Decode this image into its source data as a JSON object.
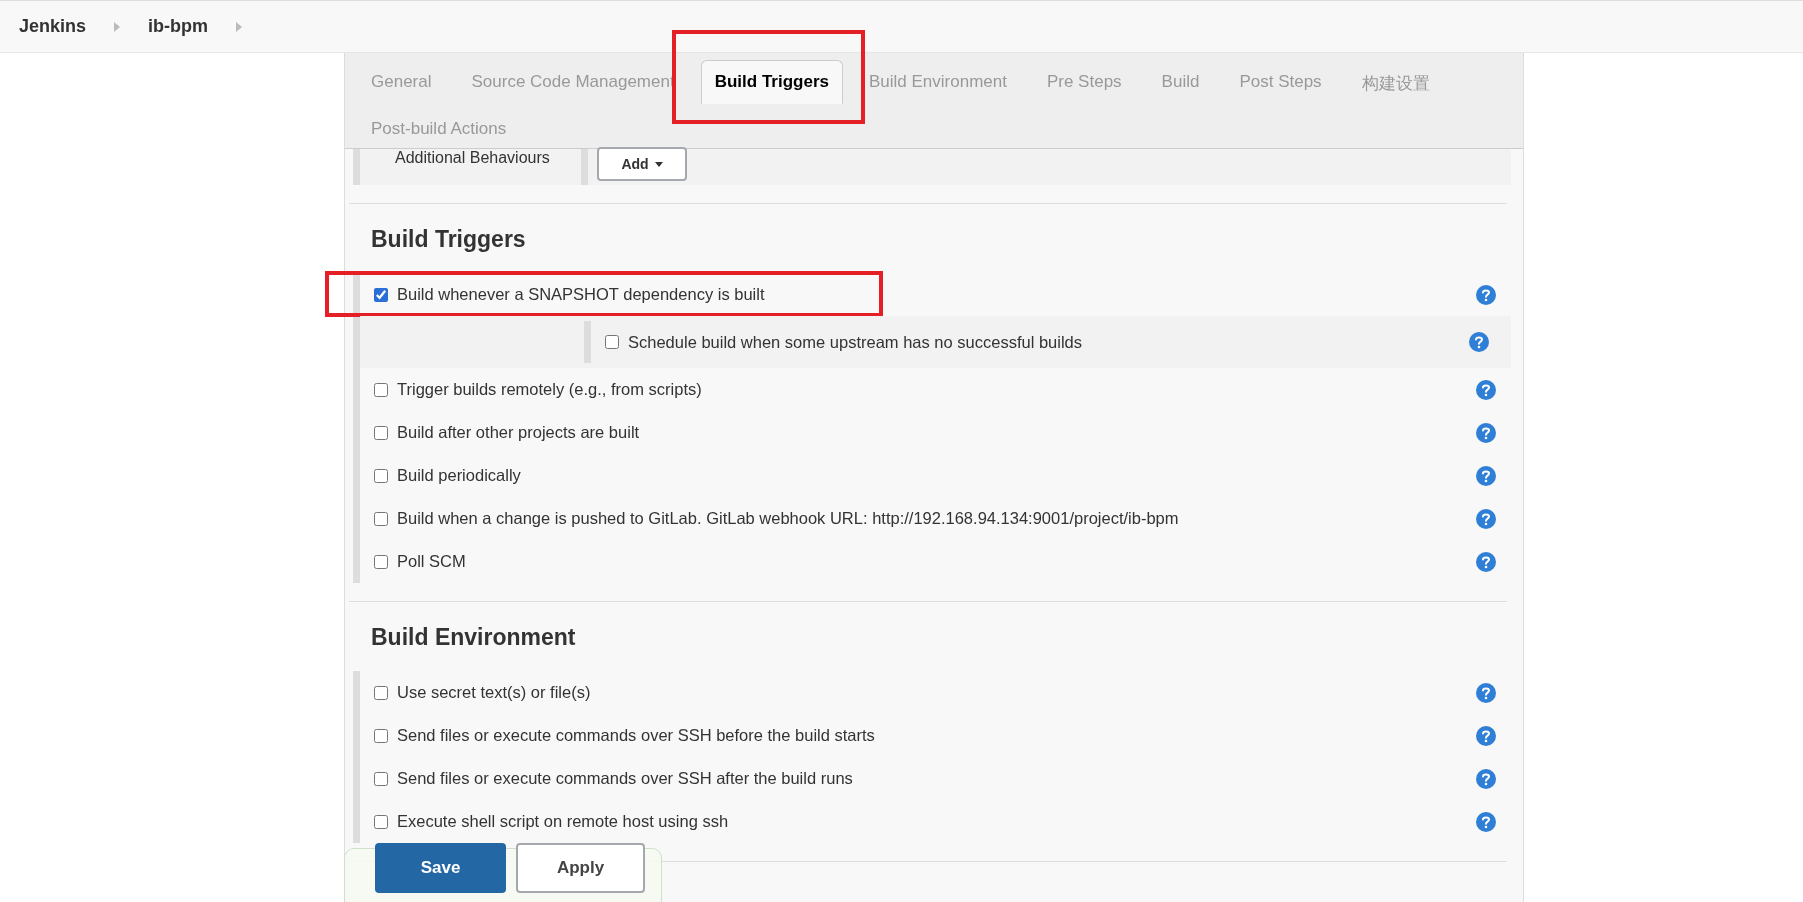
{
  "breadcrumbs": [
    {
      "label": "Jenkins"
    },
    {
      "label": "ib-bpm"
    }
  ],
  "tabs": [
    {
      "label": "General",
      "selected": false
    },
    {
      "label": "Source Code Management",
      "selected": false
    },
    {
      "label": "Build Triggers",
      "selected": true,
      "highlighted": true
    },
    {
      "label": "Build Environment",
      "selected": false
    },
    {
      "label": "Pre Steps",
      "selected": false
    },
    {
      "label": "Build",
      "selected": false
    },
    {
      "label": "Post Steps",
      "selected": false
    },
    {
      "label": "构建设置",
      "selected": false
    },
    {
      "label": "Post-build Actions",
      "selected": false
    }
  ],
  "additional_behaviours": {
    "label": "Additional Behaviours",
    "button": "Add"
  },
  "sections": [
    {
      "title": "Build Triggers",
      "options": [
        {
          "label": "Build whenever a SNAPSHOT dependency is built",
          "checked": true,
          "highlighted": true,
          "children": [
            {
              "label": "Schedule build when some upstream has no successful builds",
              "checked": false
            }
          ]
        },
        {
          "label": "Trigger builds remotely (e.g., from scripts)",
          "checked": false
        },
        {
          "label": "Build after other projects are built",
          "checked": false
        },
        {
          "label": "Build periodically",
          "checked": false
        },
        {
          "label": "Build when a change is pushed to GitLab. GitLab webhook URL: http://192.168.94.134:9001/project/ib-bpm",
          "checked": false
        },
        {
          "label": "Poll SCM",
          "checked": false
        }
      ]
    },
    {
      "title": "Build Environment",
      "options": [
        {
          "label": "Use secret text(s) or file(s)",
          "checked": false
        },
        {
          "label": "Send files or execute commands over SSH before the build starts",
          "checked": false
        },
        {
          "label": "Send files or execute commands over SSH after the build runs",
          "checked": false
        },
        {
          "label": "Execute shell script on remote host using ssh",
          "checked": false
        }
      ]
    }
  ],
  "actions": [
    {
      "label": "Save",
      "kind": "primary"
    },
    {
      "label": "Apply",
      "kind": "secondary"
    }
  ]
}
